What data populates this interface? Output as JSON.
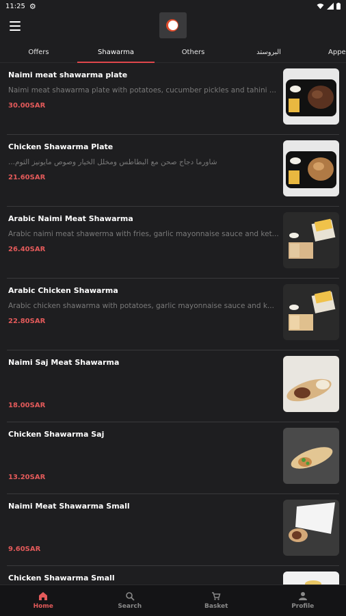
{
  "status": {
    "time": "11:25"
  },
  "tabs": [
    {
      "label": "Offers"
    },
    {
      "label": "Shawarma"
    },
    {
      "label": "Others"
    },
    {
      "label": "البروستد"
    },
    {
      "label": "Appe"
    }
  ],
  "items": [
    {
      "title": "Naimi meat shawarma plate",
      "desc": "Naimi meat shawarma plate with potatoes, cucumber pickles and tahini ...",
      "price": "30.00SAR"
    },
    {
      "title": "Chicken Shawarma Plate",
      "desc": "...شاورما دجاج صحن مع البطاطس ومخلل الخيار وصوص مايونيز الثوم",
      "price": "21.60SAR"
    },
    {
      "title": "Arabic Naimi Meat Shawarma",
      "desc": "Arabic naimi meat shawerma with fries, garlic mayonnaise sauce and ket...",
      "price": "26.40SAR"
    },
    {
      "title": "Arabic Chicken Shawarma",
      "desc": "Arabic chicken shawarma with potatoes, garlic mayonnaise sauce and k...",
      "price": "22.80SAR"
    },
    {
      "title": "Naimi Saj Meat Shawarma",
      "desc": "",
      "price": "18.00SAR"
    },
    {
      "title": "Chicken Shawarma Saj",
      "desc": "",
      "price": "13.20SAR"
    },
    {
      "title": "Naimi Meat Shawarma Small",
      "desc": "",
      "price": "9.60SAR"
    },
    {
      "title": "Chicken Shawarma Small",
      "desc": "",
      "price": ""
    }
  ],
  "nav": {
    "home": "Home",
    "search": "Search",
    "basket": "Basket",
    "profile": "Profile"
  },
  "colors": {
    "accent": "#e35a5a",
    "background": "#1e1e20"
  }
}
